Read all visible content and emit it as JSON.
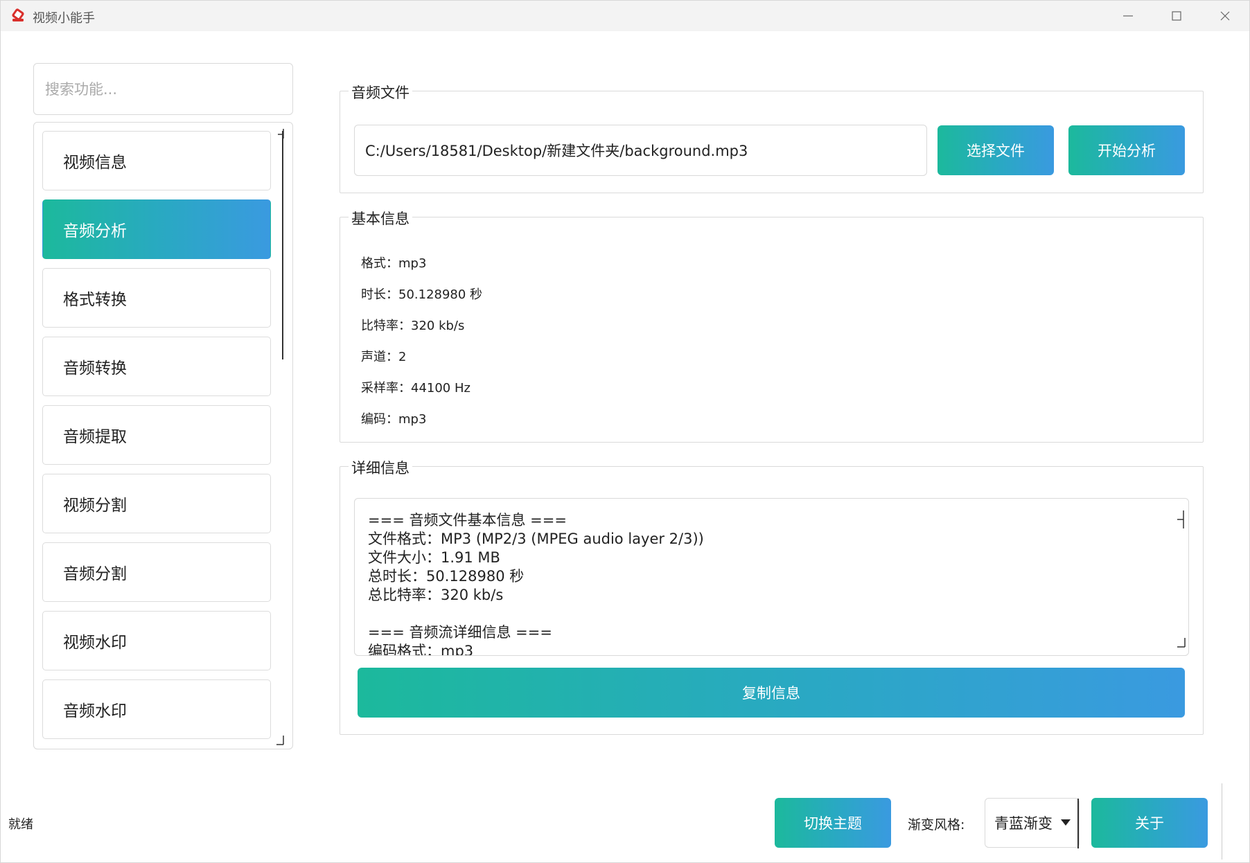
{
  "window": {
    "title": "视频小能手"
  },
  "search": {
    "placeholder": "搜索功能..."
  },
  "nav": {
    "items": [
      {
        "label": "视频信息",
        "active": false
      },
      {
        "label": "音频分析",
        "active": true
      },
      {
        "label": "格式转换",
        "active": false
      },
      {
        "label": "音频转换",
        "active": false
      },
      {
        "label": "音频提取",
        "active": false
      },
      {
        "label": "视频分割",
        "active": false
      },
      {
        "label": "音频分割",
        "active": false
      },
      {
        "label": "视频水印",
        "active": false
      },
      {
        "label": "音频水印",
        "active": false
      }
    ]
  },
  "file_group": {
    "title": "音频文件",
    "path": "C:/Users/18581/Desktop/新建文件夹/background.mp3",
    "choose_label": "选择文件",
    "analyze_label": "开始分析"
  },
  "basic_group": {
    "title": "基本信息",
    "lines": [
      "格式：mp3",
      "时长：50.128980 秒",
      "比特率：320 kb/s",
      "声道：2",
      "采样率：44100 Hz",
      "编码：mp3"
    ]
  },
  "detail_group": {
    "title": "详细信息",
    "lines": [
      "=== 音频文件基本信息 ===",
      "文件格式：MP3 (MP2/3 (MPEG audio layer 2/3))",
      "文件大小：1.91 MB",
      "总时长：50.128980 秒",
      "总比特率：320 kb/s",
      "",
      "=== 音频流详细信息 ===",
      "编码格式：mp3"
    ],
    "copy_label": "复制信息"
  },
  "footer": {
    "status": "就绪",
    "theme_label": "切换主题",
    "style_label": "渐变风格:",
    "style_value": "青蓝渐变",
    "about_label": "关于"
  },
  "colors": {
    "gradient_start": "#1cb99c",
    "gradient_end": "#3a9ae0",
    "icon_red": "#d9302c"
  }
}
